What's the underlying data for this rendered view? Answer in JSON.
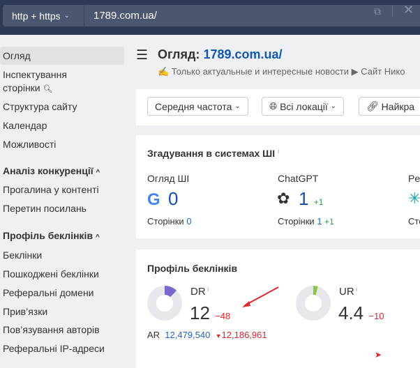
{
  "topbar": {
    "protocol": "http + https",
    "url": "1789.com.ua/"
  },
  "sidebar": {
    "items": [
      {
        "label": "Огляд",
        "active": true
      },
      {
        "label": "Інспектування"
      },
      {
        "label": "сторінки"
      },
      {
        "label": "Структура сайту"
      },
      {
        "label": "Календар"
      },
      {
        "label": "Можливості"
      },
      {
        "label": "Аналіз конкуренції",
        "section": true
      },
      {
        "label": "Прогалина у контенті"
      },
      {
        "label": "Перетин посилань"
      },
      {
        "label": "Профіль беклінків",
        "section": true
      },
      {
        "label": "Беклінки"
      },
      {
        "label": "Пошкоджені беклінки"
      },
      {
        "label": "Реферальні домени"
      },
      {
        "label": "Прив’язки"
      },
      {
        "label": "Пов’язування авторів"
      },
      {
        "label": "Реферальні IP-адреси"
      }
    ]
  },
  "header": {
    "title_prefix": "Огляд:",
    "title_domain": "1789.com.ua/",
    "subtitle": "✍ Только актуальные и интересные новости ▶ Сайт Нико"
  },
  "filters": [
    {
      "label": "Середня частота"
    },
    {
      "label": "Всі локації"
    },
    {
      "label": "Найкра"
    }
  ],
  "ai_card": {
    "title": "Згадування в системах ШІ",
    "cols": [
      {
        "label": "Огляд ШІ",
        "value": "0",
        "delta": "",
        "pages_label": "Сторінки",
        "pages": "0",
        "pages_delta": ""
      },
      {
        "label": "ChatGPT",
        "value": "1",
        "delta": "+1",
        "pages_label": "Сторінки",
        "pages": "1",
        "pages_delta": "+1"
      },
      {
        "label": "Pe",
        "pages_label": "Сто"
      }
    ]
  },
  "backlinks_card": {
    "title": "Профіль беклінків",
    "dr": {
      "label": "DR",
      "value": "12",
      "delta": "−48",
      "fill_percent": 12,
      "color": "#7b68cf"
    },
    "ur": {
      "label": "UR",
      "value": "4.4",
      "delta": "−10",
      "fill_percent": 4.4,
      "color": "#8dc63f"
    },
    "ar": {
      "label": "AR",
      "value": "12,479,540",
      "delta": "12,186,961"
    }
  }
}
